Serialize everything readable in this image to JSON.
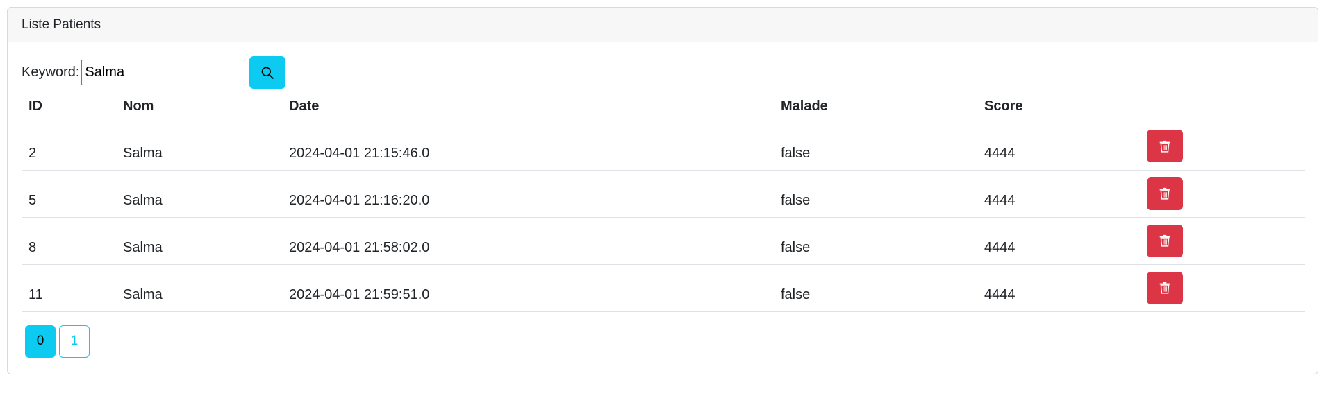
{
  "card": {
    "title": "Liste Patients"
  },
  "search": {
    "label": "Keyword:",
    "value": "Salma",
    "button_icon": "search-icon"
  },
  "table": {
    "headers": {
      "id": "ID",
      "nom": "Nom",
      "date": "Date",
      "malade": "Malade",
      "score": "Score"
    },
    "rows": [
      {
        "id": "2",
        "nom": "Salma",
        "date": "2024-04-01 21:15:46.0",
        "malade": "false",
        "score": "4444"
      },
      {
        "id": "5",
        "nom": "Salma",
        "date": "2024-04-01 21:16:20.0",
        "malade": "false",
        "score": "4444"
      },
      {
        "id": "8",
        "nom": "Salma",
        "date": "2024-04-01 21:58:02.0",
        "malade": "false",
        "score": "4444"
      },
      {
        "id": "11",
        "nom": "Salma",
        "date": "2024-04-01 21:59:51.0",
        "malade": "false",
        "score": "4444"
      }
    ],
    "delete_icon": "trash-icon"
  },
  "pagination": {
    "pages": [
      "0",
      "1"
    ],
    "current": "0"
  },
  "colors": {
    "info": "#0dcaf0",
    "danger": "#dc3545"
  }
}
